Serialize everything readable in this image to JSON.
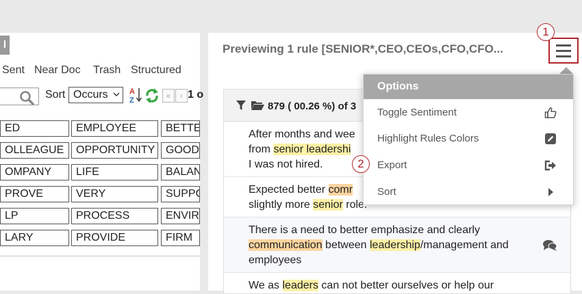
{
  "left": {
    "chip": "l",
    "tabs": [
      "Sent",
      "Near Doc",
      "Trash",
      "Structured"
    ],
    "sort_label": "Sort",
    "sort_value": "Occurs",
    "pager": {
      "first": "«",
      "prev": "‹",
      "page": "1 o"
    },
    "grid": [
      [
        "ED",
        "EMPLOYEE",
        "BETTER"
      ],
      [
        "OLLEAGUE",
        "OPPORTUNITY",
        "GOOD"
      ],
      [
        "OMPANY",
        "LIFE",
        "BALANCE"
      ],
      [
        "PROVE",
        "VERY",
        "SUPPORT"
      ],
      [
        "LP",
        "PROCESS",
        "ENVIRONMENT"
      ],
      [
        "LARY",
        "PROVIDE",
        "FIRM"
      ]
    ]
  },
  "preview": {
    "title": "Previewing 1 rule [SENIOR*,CEO,CEOs,CFO,CFO...",
    "count": "879 ( 00.26 %) of 3"
  },
  "results": [
    {
      "parts": [
        {
          "t": "After months and wee"
        },
        {
          "br": true
        },
        {
          "t": "from "
        },
        {
          "t": "senior leadershi",
          "hl": "y"
        },
        {
          "br": true
        },
        {
          "t": "I was not hired."
        }
      ]
    },
    {
      "parts": [
        {
          "t": "Expected better "
        },
        {
          "t": "comr",
          "hl": "o"
        },
        {
          "br": true
        },
        {
          "t": "slightly more "
        },
        {
          "t": "senior",
          "hl": "y"
        },
        {
          "t": " role."
        }
      ]
    },
    {
      "parts": [
        {
          "t": "There is a need to better emphasize and clearly"
        },
        {
          "br": true
        },
        {
          "t": "communication",
          "hl": "o"
        },
        {
          "t": " between "
        },
        {
          "t": "leadership",
          "hl": "y"
        },
        {
          "t": "/management and"
        },
        {
          "br": true
        },
        {
          "t": "employees"
        }
      ]
    },
    {
      "parts": [
        {
          "t": "We as "
        },
        {
          "t": "leaders",
          "hl": "y"
        },
        {
          "t": " can not better ourselves or help our"
        }
      ]
    }
  ],
  "options": {
    "header": "Options",
    "items": [
      {
        "label": "Toggle Sentiment",
        "icon": "thumbs-up-icon"
      },
      {
        "label": "Highlight Rules Colors",
        "icon": "edit-icon"
      },
      {
        "label": "Export",
        "icon": "export-icon"
      },
      {
        "label": "Sort",
        "icon": "caret-right-icon"
      }
    ]
  },
  "steps": [
    "1",
    "2"
  ],
  "colors": {
    "accent": "#b3262c",
    "highlight_yellow": "#fbf0a6",
    "highlight_orange": "#fbd5a0",
    "menu_header": "#a7a7a7"
  }
}
